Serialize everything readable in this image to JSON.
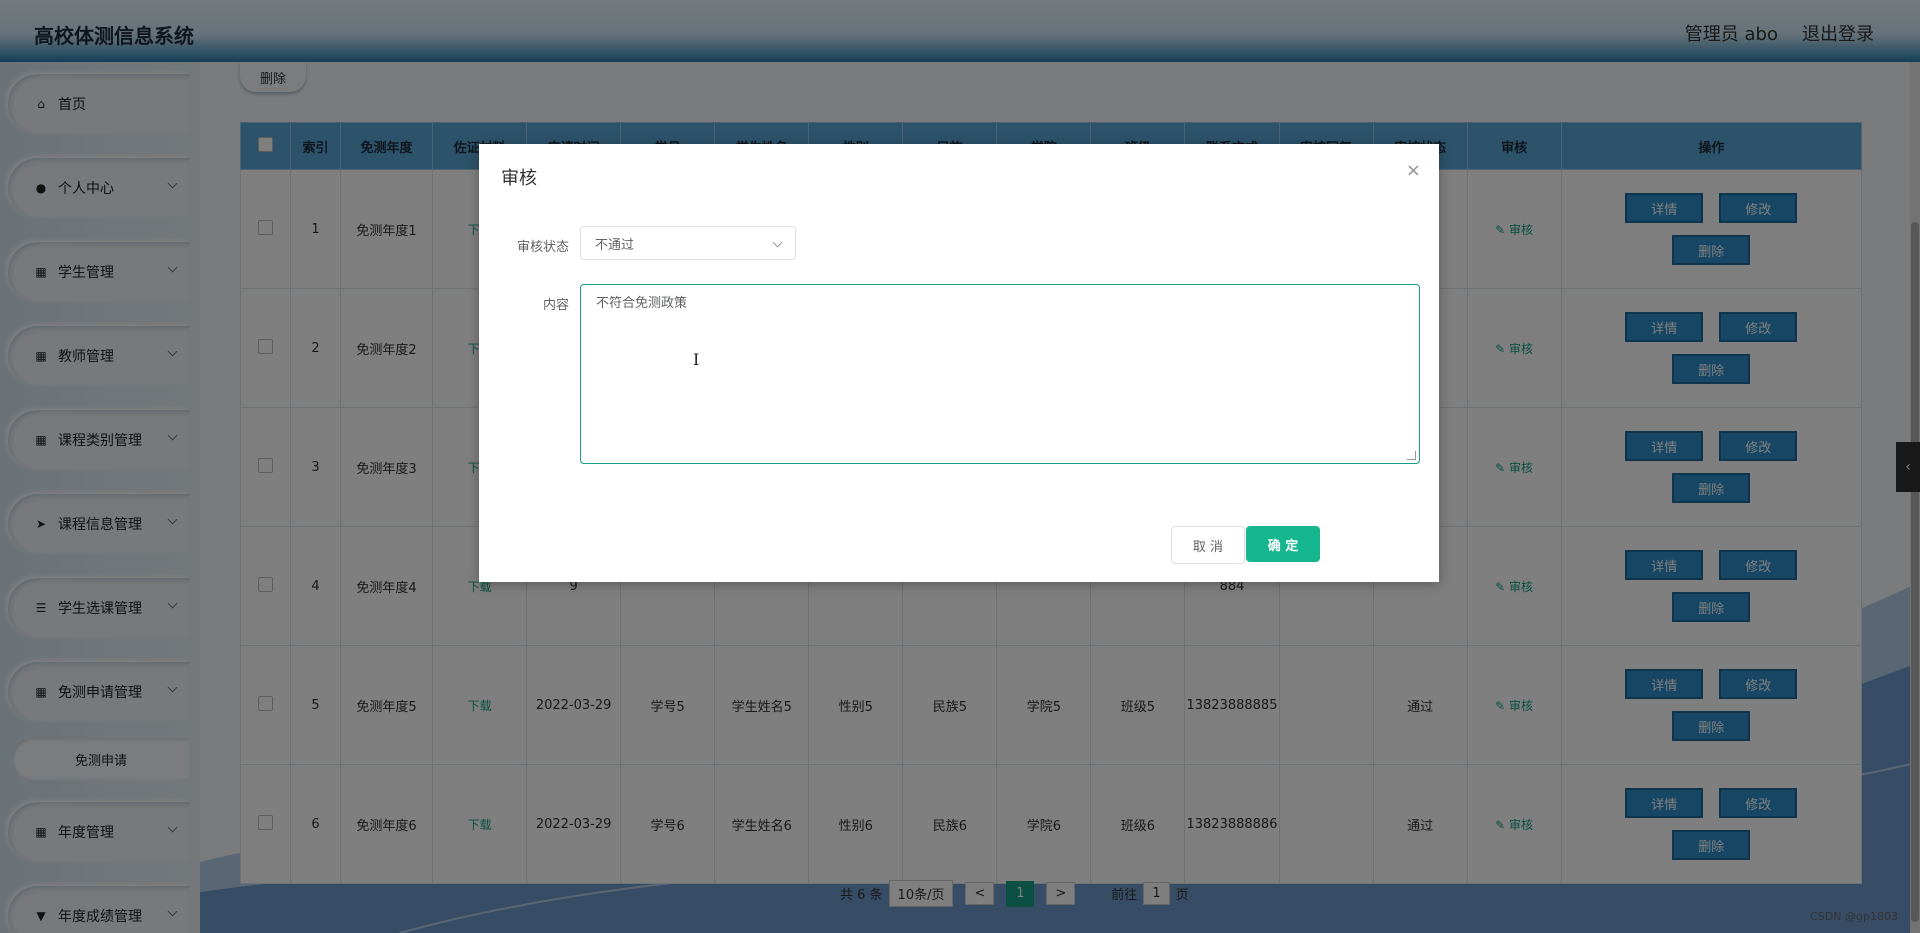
{
  "header": {
    "title": "高校体测信息系统",
    "admin": "管理员 abo",
    "logout": "退出登录"
  },
  "sidebar": {
    "items": [
      {
        "label": "首页",
        "icon": "home-icon",
        "glyph": "⌂"
      },
      {
        "label": "个人中心",
        "icon": "user-icon",
        "glyph": "●"
      },
      {
        "label": "学生管理",
        "icon": "grid-icon",
        "glyph": "▦"
      },
      {
        "label": "教师管理",
        "icon": "grid-icon",
        "glyph": "▦"
      },
      {
        "label": "课程类别管理",
        "icon": "grid-icon",
        "glyph": "▦"
      },
      {
        "label": "课程信息管理",
        "icon": "send-icon",
        "glyph": "➤"
      },
      {
        "label": "学生选课管理",
        "icon": "sliders-icon",
        "glyph": "☰"
      },
      {
        "label": "免测申请管理",
        "icon": "apps-icon",
        "glyph": "▦"
      },
      {
        "label": "年度管理",
        "icon": "grid-icon",
        "glyph": "▦"
      },
      {
        "label": "年度成绩管理",
        "icon": "cup-icon",
        "glyph": "▼"
      }
    ],
    "sub_item": "免测申请"
  },
  "toolbar": {
    "delete_label": "删除"
  },
  "table": {
    "columns": [
      "",
      "索引",
      "免测年度",
      "佐证材料",
      "申请时间",
      "学号",
      "学生姓名",
      "性别",
      "民族",
      "学院",
      "班级",
      "联系方式",
      "审核回复",
      "审核状态",
      "审核",
      "操作"
    ],
    "rows": [
      {
        "index": "1",
        "year": "免测年度1",
        "file": "下载",
        "time": "",
        "sid": "",
        "name": "",
        "gender": "",
        "nation": "",
        "college": "",
        "cls": "",
        "phone": "",
        "reply": "",
        "status": "",
        "audit": "✎ 审核"
      },
      {
        "index": "2",
        "year": "免测年度2",
        "file": "下载",
        "time": "",
        "sid": "",
        "name": "",
        "gender": "",
        "nation": "",
        "college": "",
        "cls": "",
        "phone": "",
        "reply": "",
        "status": "",
        "audit": "✎ 审核"
      },
      {
        "index": "3",
        "year": "免测年度3",
        "file": "下载",
        "time": "",
        "sid": "",
        "name": "",
        "gender": "",
        "nation": "",
        "college": "",
        "cls": "",
        "phone": "",
        "reply": "",
        "status": "",
        "audit": "✎ 审核"
      },
      {
        "index": "4",
        "year": "免测年度4",
        "file": "下载",
        "time": "9",
        "sid": "",
        "name": "",
        "gender": "",
        "nation": "",
        "college": "",
        "cls": "",
        "phone": "884",
        "reply": "",
        "status": "",
        "audit": "✎ 审核"
      },
      {
        "index": "5",
        "year": "免测年度5",
        "file": "下载",
        "time": "2022-03-29",
        "sid": "学号5",
        "name": "学生姓名5",
        "gender": "性别5",
        "nation": "民族5",
        "college": "学院5",
        "cls": "班级5",
        "phone": "13823888885",
        "reply": "",
        "status": "通过",
        "audit": "✎ 审核"
      },
      {
        "index": "6",
        "year": "免测年度6",
        "file": "下载",
        "time": "2022-03-29",
        "sid": "学号6",
        "name": "学生姓名6",
        "gender": "性别6",
        "nation": "民族6",
        "college": "学院6",
        "cls": "班级6",
        "phone": "13823888886",
        "reply": "",
        "status": "通过",
        "audit": "✎ 审核"
      }
    ],
    "ops": {
      "detail": "详情",
      "edit": "修改",
      "delete": "删除"
    }
  },
  "pager": {
    "total": "共 6 条",
    "size": "10条/页",
    "prev": "<",
    "page": "1",
    "next": ">",
    "goto": "前往",
    "goto_value": "1",
    "unit": "页"
  },
  "dialog": {
    "title": "审核",
    "close": "×",
    "status_label": "审核状态",
    "status_value": "不通过",
    "content_label": "内容",
    "content_value": "不符合免测政策",
    "cancel": "取 消",
    "confirm": "确 定"
  },
  "misc": {
    "watermark": "CSDN @gp1803",
    "handle": "‹",
    "accent": "#16a085"
  }
}
